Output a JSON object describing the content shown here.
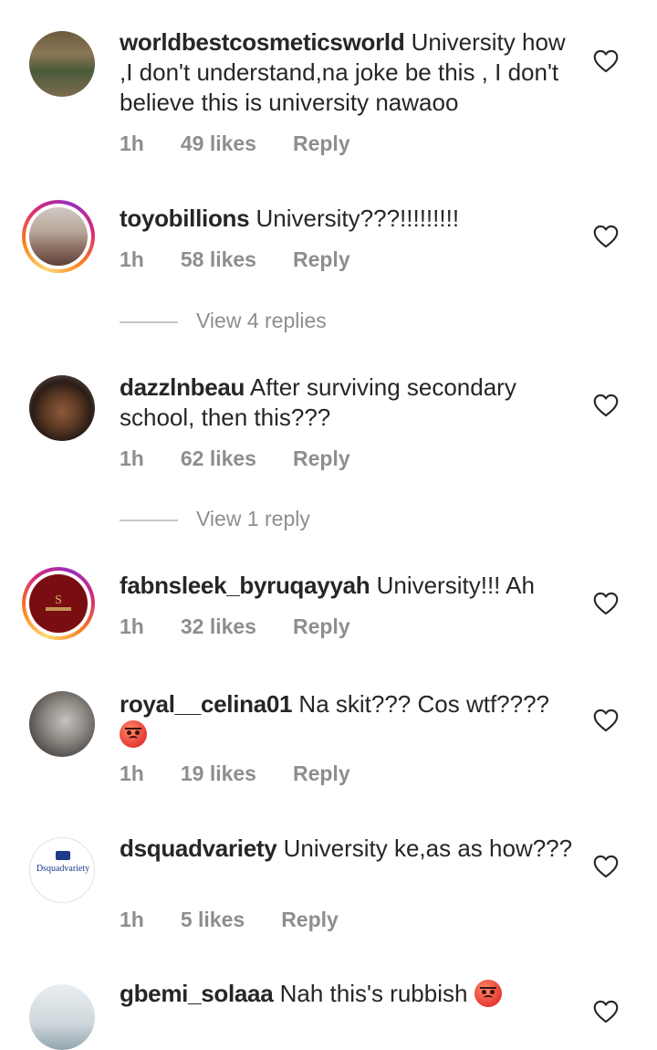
{
  "comments": [
    {
      "username": "worldbestcosmeticsworld",
      "text": " University how ,I don't understand,na joke be this , I don't believe this is university nawaoo",
      "time": "1h",
      "likes": "49 likes",
      "reply": "Reply"
    },
    {
      "username": "toyobillions",
      "text": " University???!!!!!!!!!",
      "time": "1h",
      "likes": "58 likes",
      "reply": "Reply",
      "view_replies": "View 4 replies"
    },
    {
      "username": "dazzlnbeau",
      "text": " After surviving secondary school, then this???",
      "time": "1h",
      "likes": "62 likes",
      "reply": "Reply",
      "view_replies": "View 1 reply"
    },
    {
      "username": "fabnsleek_byruqayyah",
      "text": " University!!! Ah",
      "time": "1h",
      "likes": "32 likes",
      "reply": "Reply"
    },
    {
      "username": "royal__celina01",
      "text": " Na skit??? Cos wtf????",
      "emoji": "angry-face-emoji",
      "time": "1h",
      "likes": "19 likes",
      "reply": "Reply"
    },
    {
      "username": "dsquadvariety",
      "text": " University ke,as as how???",
      "time": "1h",
      "likes": "5 likes",
      "reply": "Reply",
      "avatar_text": "Dsquadvariety"
    },
    {
      "username": "gbemi_solaaa",
      "text": " Nah this's rubbish",
      "emoji": "angry-face-emoji"
    }
  ],
  "colors": {
    "text": "#262626",
    "muted": "#8e8e8e",
    "story_ring": [
      "#feda75",
      "#fa7e1e",
      "#d62976",
      "#962fbf"
    ]
  },
  "icons": {
    "like": "heart-outline-icon"
  }
}
